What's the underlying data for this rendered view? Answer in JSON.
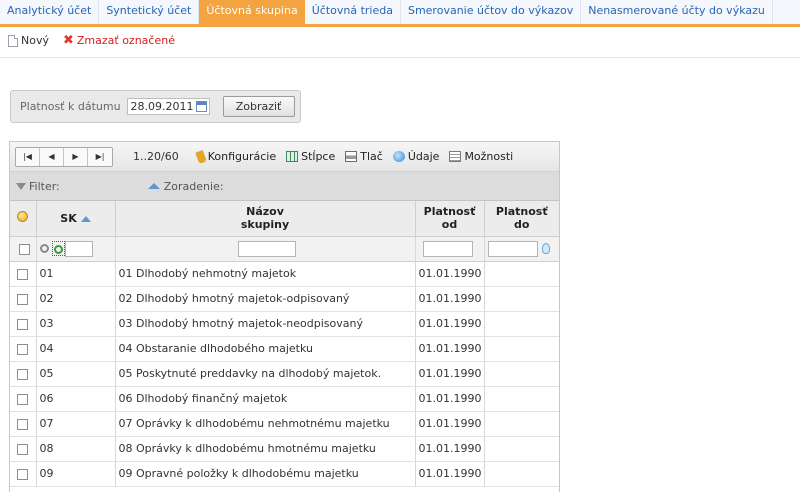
{
  "tabs": [
    {
      "label": "Analytický účet",
      "active": false
    },
    {
      "label": "Syntetický účet",
      "active": false
    },
    {
      "label": "Účtovná skupina",
      "active": true
    },
    {
      "label": "Účtovná trieda",
      "active": false
    },
    {
      "label": "Smerovanie účtov do výkazov",
      "active": false
    },
    {
      "label": "Nenasmerované účty do výkazu",
      "active": false
    }
  ],
  "toolbar": {
    "new_label": "Nový",
    "delete_label": "Zmazať označené"
  },
  "date_filter": {
    "label": "Platnosť k dátumu",
    "value": "28.09.2011",
    "button_label": "Zobraziť"
  },
  "pager": {
    "info": "1..20/60",
    "config_label": "Konfigurácie",
    "columns_label": "Stĺpce",
    "print_label": "Tlač",
    "data_label": "Údaje",
    "options_label": "Možnosti"
  },
  "filterbar": {
    "filter_label": "Filter:",
    "sort_label": "Zoradenie:"
  },
  "columns": {
    "sk": "SK",
    "name_line1": "Názov",
    "name_line2": "skupiny",
    "from_line1": "Platnosť",
    "from_line2": "od",
    "to_line1": "Platnosť",
    "to_line2": "do"
  },
  "rows": [
    {
      "sk": "01",
      "name": "01 Dlhodobý nehmotný majetok",
      "from": "01.01.1990",
      "to": ""
    },
    {
      "sk": "02",
      "name": "02 Dlhodobý hmotný majetok-odpisovaný",
      "from": "01.01.1990",
      "to": ""
    },
    {
      "sk": "03",
      "name": "03 Dlhodobý hmotný majetok-neodpisovaný",
      "from": "01.01.1990",
      "to": ""
    },
    {
      "sk": "04",
      "name": "04 Obstaranie dlhodobého majetku",
      "from": "01.01.1990",
      "to": ""
    },
    {
      "sk": "05",
      "name": "05 Poskytnuté preddavky na dlhodobý majetok.",
      "from": "01.01.1990",
      "to": ""
    },
    {
      "sk": "06",
      "name": "06 Dlhodobý finančný majetok",
      "from": "01.01.1990",
      "to": ""
    },
    {
      "sk": "07",
      "name": "07 Oprávky k dlhodobému nehmotnému majetku",
      "from": "01.01.1990",
      "to": ""
    },
    {
      "sk": "08",
      "name": "08 Oprávky k dlhodobému hmotnému majetku",
      "from": "01.01.1990",
      "to": ""
    },
    {
      "sk": "09",
      "name": "09 Opravné položky k dlhodobému majetku",
      "from": "01.01.1990",
      "to": ""
    }
  ]
}
